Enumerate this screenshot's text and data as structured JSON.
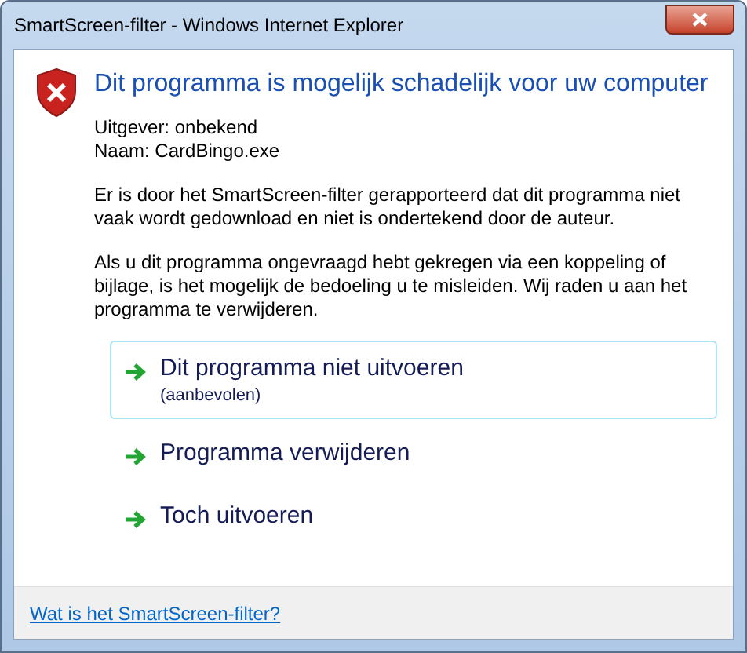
{
  "window": {
    "title": "SmartScreen-filter - Windows Internet Explorer"
  },
  "heading": "Dit programma is mogelijk schadelijk voor uw computer",
  "details": [
    "Uitgever: onbekend",
    "Naam: CardBingo.exe"
  ],
  "paragraphs": [
    "Er is door het SmartScreen-filter gerapporteerd dat dit programma niet vaak wordt gedownload en niet is ondertekend door de auteur.",
    "Als u dit programma ongevraagd hebt gekregen via een koppeling of bijlage, is het mogelijk de bedoeling u te misleiden. Wij raden u aan het programma te verwijderen."
  ],
  "options": [
    {
      "label": "Dit programma niet uitvoeren",
      "note": "(aanbevolen)",
      "selected": true
    },
    {
      "label": "Programma verwijderen",
      "selected": false
    },
    {
      "label": "Toch uitvoeren",
      "selected": false
    }
  ],
  "footer_link": "Wat is het SmartScreen-filter?"
}
